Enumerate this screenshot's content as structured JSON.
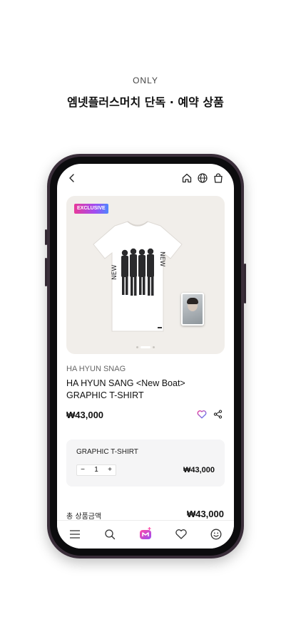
{
  "promo": {
    "eyebrow": "ONLY",
    "headline": "엠넷플러스머치 단독 · 예약 상품"
  },
  "app": {
    "topnav": {
      "icons": [
        "back-icon",
        "home-icon",
        "globe-icon",
        "bag-icon"
      ]
    },
    "product": {
      "badge": "EXCLUSIVE",
      "artist": "HA HYUN SNAG",
      "title": "HA HYUN SANG <New Boat> GRAPHIC T-SHIRT",
      "price": "₩43,000",
      "image_pages": 3,
      "image_active_page": 2
    },
    "option": {
      "name": "GRAPHIC T-SHIRT",
      "quantity": "1",
      "minus_label": "−",
      "plus_label": "+",
      "price": "₩43,000"
    },
    "total": {
      "label": "총 상품금액",
      "price": "₩43,000"
    },
    "bottom_nav": [
      "menu-icon",
      "search-icon",
      "mnet-plus-logo-icon",
      "heart-icon",
      "smile-icon"
    ]
  },
  "colors": {
    "badge_gradient_start": "#e8399a",
    "badge_gradient_end": "#4f86ff",
    "phone_frame": "#3a2e3a",
    "image_bg": "#f1eeea"
  }
}
